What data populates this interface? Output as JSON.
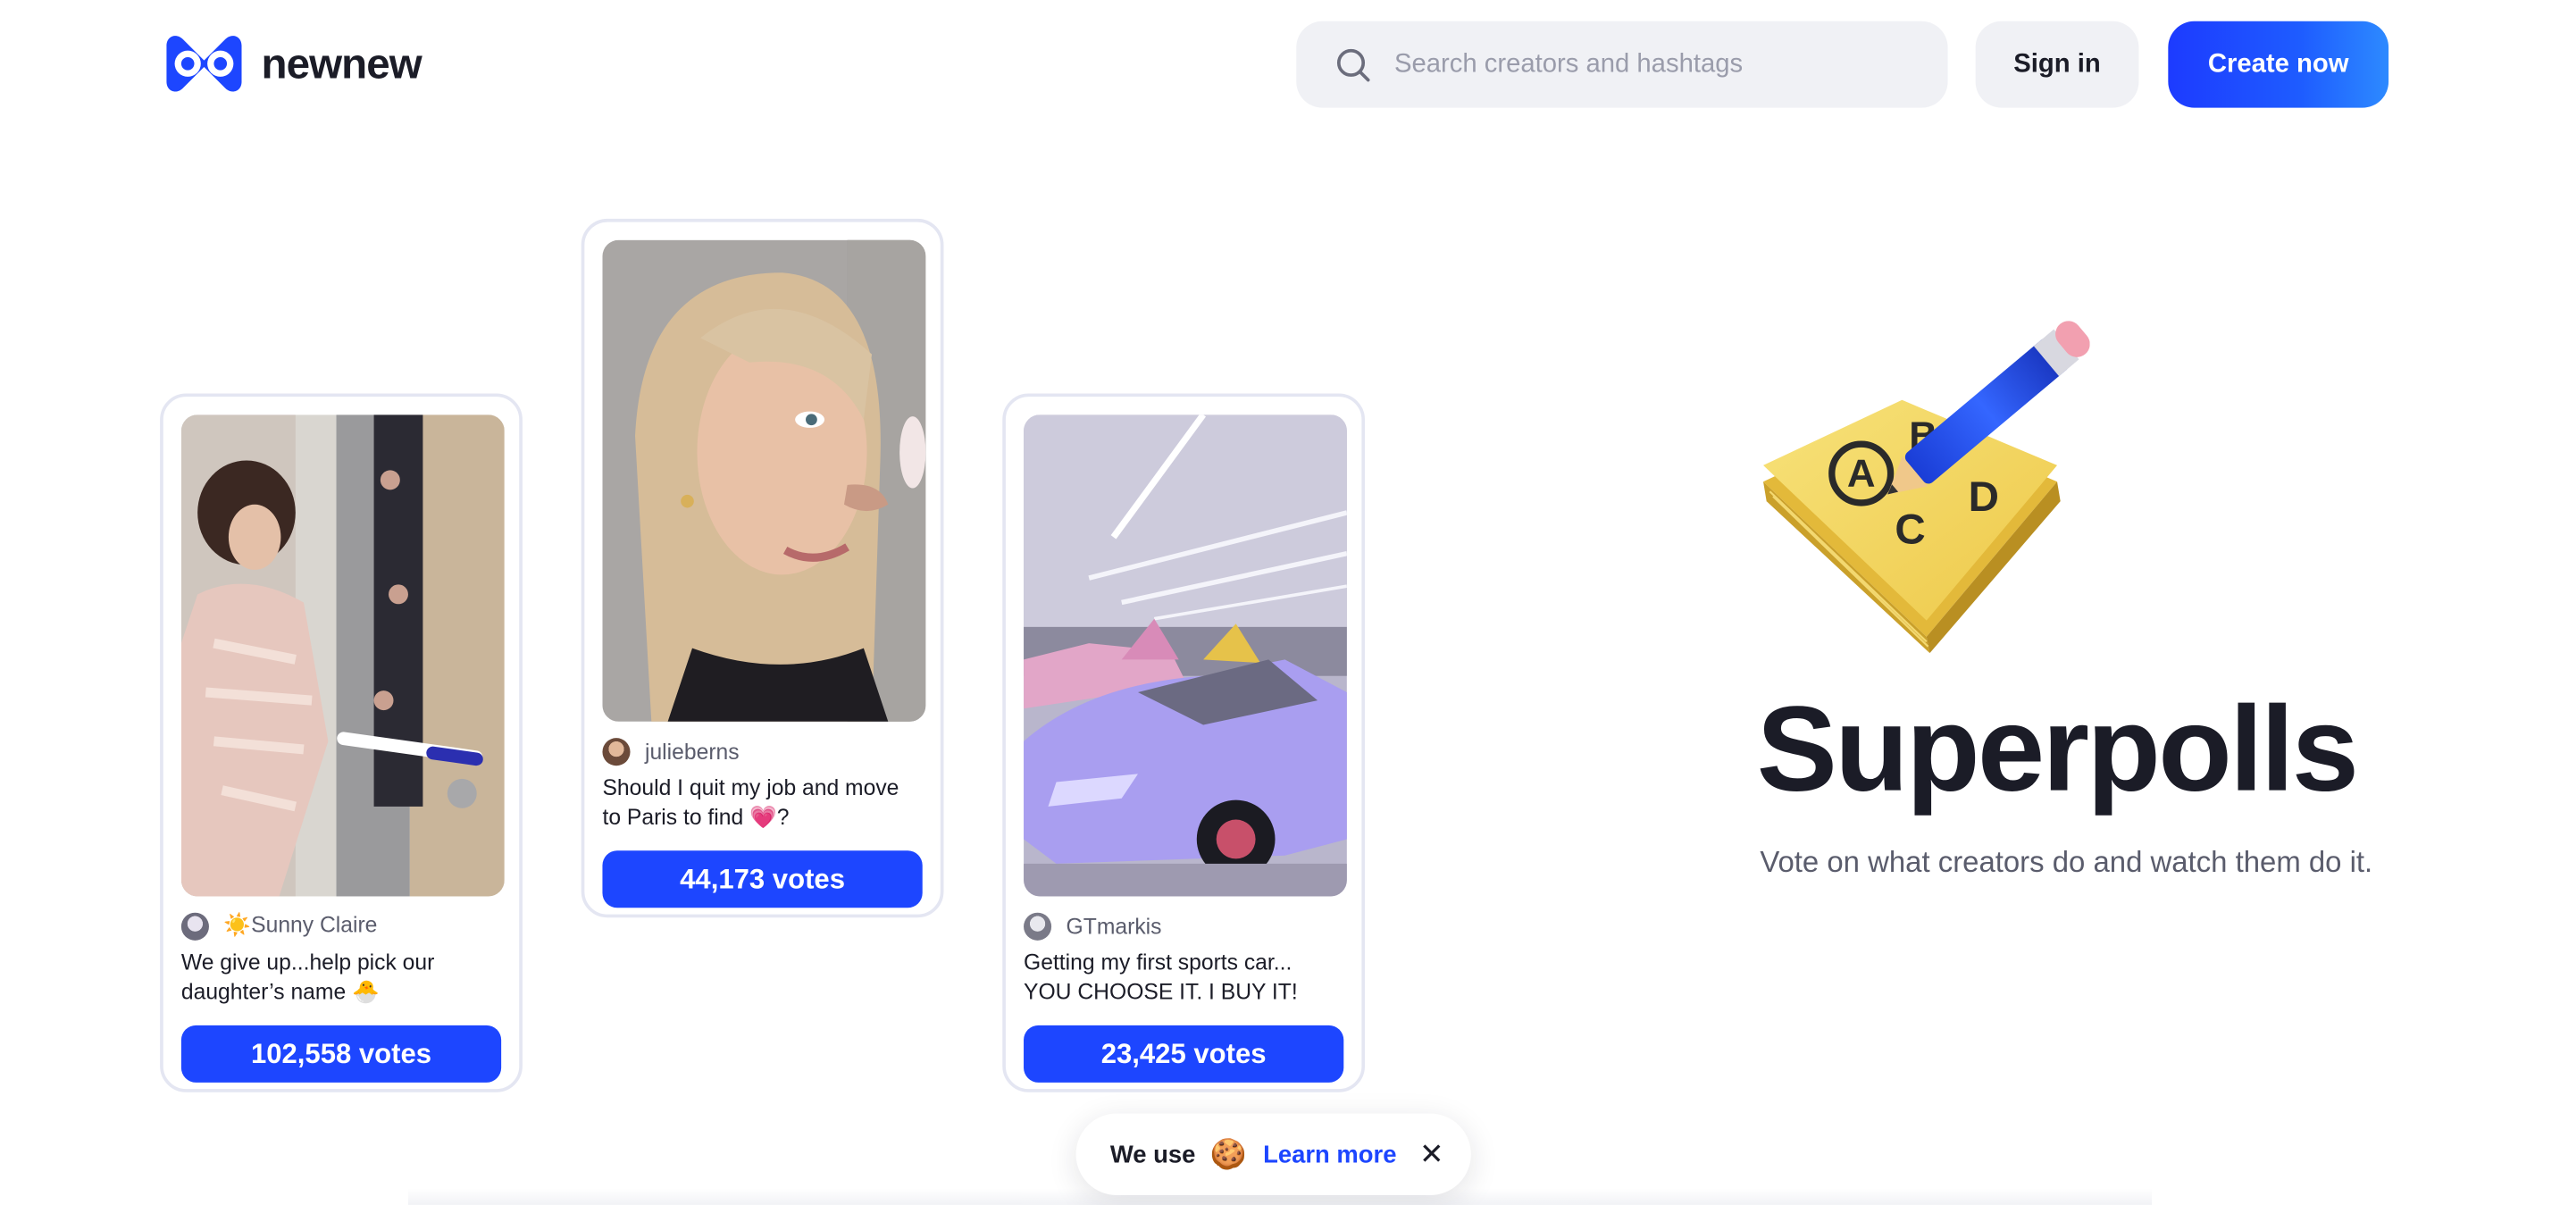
{
  "header": {
    "logo_text": "newnew",
    "search_placeholder": "Search creators and hashtags",
    "signin_label": "Sign in",
    "create_label": "Create now"
  },
  "cards": [
    {
      "author": "☀️Sunny Claire",
      "title": "We give up...help pick our daughter’s name 🐣",
      "votes": "102,558 votes"
    },
    {
      "author": "julieberns",
      "title": "Should I quit my job and move to Paris to find 💗?",
      "votes": "44,173 votes"
    },
    {
      "author": "GTmarkis",
      "title": "Getting my first sports car... YOU CHOOSE IT. I BUY IT!",
      "votes": "23,425 votes"
    }
  ],
  "hero": {
    "title": "Superpolls",
    "subtitle": "Vote on what creators do and watch them do it.",
    "illustration_letters": [
      "A",
      "B",
      "C",
      "D"
    ]
  },
  "cookie": {
    "text": "We use",
    "icon": "🍪",
    "link": "Learn more",
    "close": "✕"
  },
  "colors": {
    "accent": "#1d46ff",
    "text": "#1b1c27",
    "muted": "#5a5c6c",
    "surface": "#f0f1f5"
  }
}
